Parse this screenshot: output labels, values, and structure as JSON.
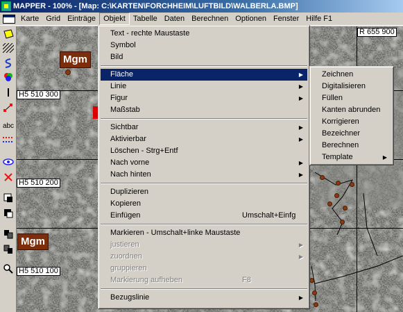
{
  "window": {
    "title": "MAPPER - 100% - [Map: C:\\KARTEN\\FORCHHEIM\\LUFTBILD\\WALBERLA.BMP]"
  },
  "menubar": [
    "Karte",
    "Grid",
    "Einträge",
    "Objekt",
    "Tabelle",
    "Daten",
    "Berechnen",
    "Optionen",
    "Fenster",
    "Hilfe F1"
  ],
  "map": {
    "grid_labels": [
      "R 655 900",
      "H5 510 300",
      "H5 510 200",
      "H5 510 100"
    ],
    "markers": [
      "Mgm",
      "Mgm"
    ]
  },
  "toolbar": {
    "text_tool": "abc"
  },
  "objekt_menu": [
    {
      "label": "Text - rechte Maustaste",
      "accel": "",
      "submenu": false,
      "disabled": false
    },
    {
      "label": "Symbol",
      "accel": "",
      "submenu": false,
      "disabled": false
    },
    {
      "label": "Bild",
      "accel": "",
      "submenu": false,
      "disabled": false
    },
    {
      "sep": true
    },
    {
      "label": "Fläche",
      "accel": "",
      "submenu": true,
      "disabled": false,
      "highlight": true
    },
    {
      "label": "Linie",
      "accel": "",
      "submenu": true,
      "disabled": false
    },
    {
      "label": "Figur",
      "accel": "",
      "submenu": true,
      "disabled": false
    },
    {
      "label": "Maßstab",
      "accel": "",
      "submenu": false,
      "disabled": false
    },
    {
      "sep": true
    },
    {
      "label": "Sichtbar",
      "accel": "",
      "submenu": true,
      "disabled": false
    },
    {
      "label": "Aktivierbar",
      "accel": "",
      "submenu": true,
      "disabled": false
    },
    {
      "label": "Löschen - Strg+Entf",
      "accel": "",
      "submenu": false,
      "disabled": false
    },
    {
      "label": "Nach vorne",
      "accel": "",
      "submenu": true,
      "disabled": false
    },
    {
      "label": "Nach hinten",
      "accel": "",
      "submenu": true,
      "disabled": false
    },
    {
      "sep": true
    },
    {
      "label": "Duplizieren",
      "accel": "",
      "submenu": false,
      "disabled": false
    },
    {
      "label": "Kopieren",
      "accel": "",
      "submenu": false,
      "disabled": false
    },
    {
      "label": "Einfügen",
      "accel": "Umschalt+Einfg",
      "submenu": false,
      "disabled": false
    },
    {
      "sep": true
    },
    {
      "label": "Markieren - Umschalt+linke Maustaste",
      "accel": "",
      "submenu": false,
      "disabled": false
    },
    {
      "label": "justieren",
      "accel": "",
      "submenu": true,
      "disabled": true
    },
    {
      "label": "zuordnen",
      "accel": "",
      "submenu": true,
      "disabled": true
    },
    {
      "label": "gruppieren",
      "accel": "",
      "submenu": false,
      "disabled": true
    },
    {
      "label": "Markierung aufheben",
      "accel": "F8",
      "submenu": false,
      "disabled": true
    },
    {
      "sep": true
    },
    {
      "label": "Bezugslinie",
      "accel": "",
      "submenu": true,
      "disabled": false
    }
  ],
  "flaeche_submenu": [
    {
      "label": "Zeichnen",
      "submenu": false
    },
    {
      "label": "Digitalisieren",
      "submenu": false
    },
    {
      "label": "Füllen",
      "submenu": false
    },
    {
      "label": "Kanten abrunden",
      "submenu": false
    },
    {
      "label": "Korrigieren",
      "submenu": false
    },
    {
      "label": "Bezeichner",
      "submenu": false
    },
    {
      "label": "Berechnen",
      "submenu": false
    },
    {
      "label": "Template",
      "submenu": true
    }
  ],
  "colors": {
    "menu_highlight": "#0a246a",
    "menu_bg": "#d4d0c8",
    "marker_bg": "#7b2d0c"
  }
}
